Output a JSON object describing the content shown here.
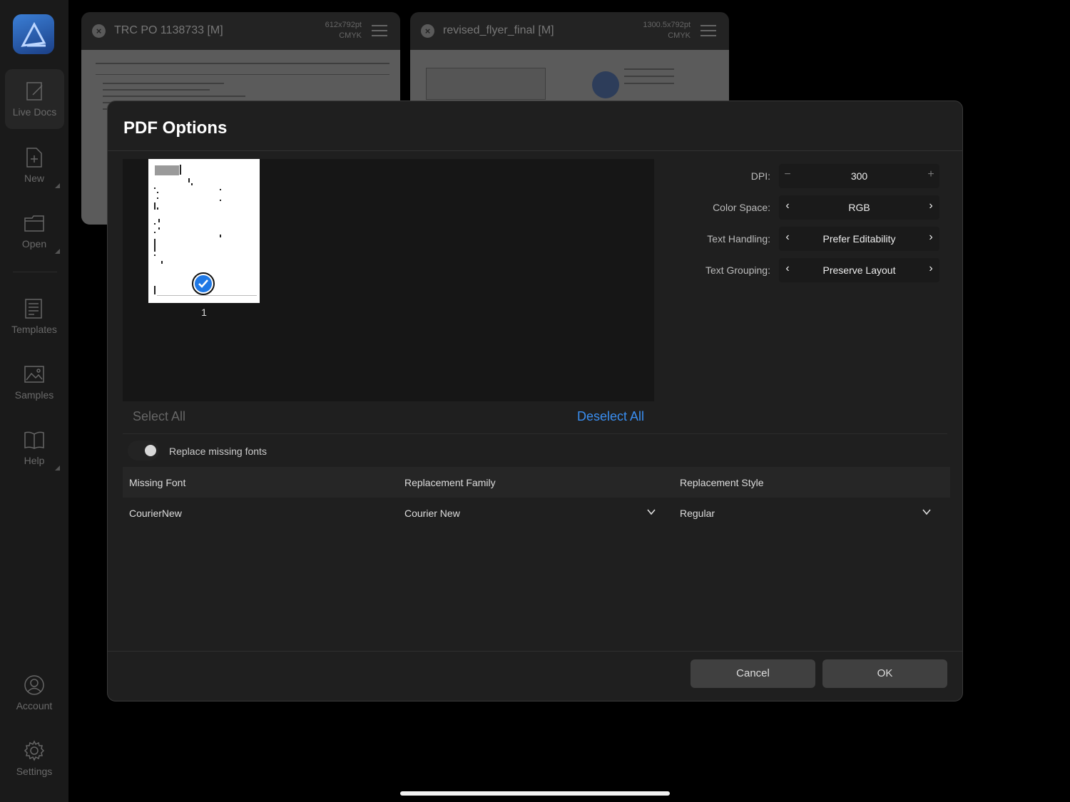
{
  "sidebar": {
    "items": [
      {
        "label": "Live Docs"
      },
      {
        "label": "New"
      },
      {
        "label": "Open"
      },
      {
        "label": "Templates"
      },
      {
        "label": "Samples"
      },
      {
        "label": "Help"
      },
      {
        "label": "Account"
      },
      {
        "label": "Settings"
      }
    ]
  },
  "documents": [
    {
      "title": "TRC PO 1138733 [M]",
      "size": "612x792pt",
      "color_mode": "CMYK"
    },
    {
      "title": "revised_flyer_final [M]",
      "size": "1300.5x792pt",
      "color_mode": "CMYK"
    }
  ],
  "dialog": {
    "title": "PDF Options",
    "page_number": "1",
    "select_all": "Select All",
    "deselect_all": "Deselect All",
    "replace_fonts_label": "Replace missing fonts",
    "settings": {
      "dpi_label": "DPI:",
      "dpi_value": "300",
      "dpi_minus": "−",
      "dpi_plus": "+",
      "color_space_label": "Color Space:",
      "color_space_value": "RGB",
      "text_handling_label": "Text Handling:",
      "text_handling_value": "Prefer Editability",
      "text_grouping_label": "Text Grouping:",
      "text_grouping_value": "Preserve Layout"
    },
    "font_table": {
      "headers": [
        "Missing Font",
        "Replacement Family",
        "Replacement Style"
      ],
      "rows": [
        {
          "missing": "CourierNew",
          "family": "Courier New",
          "style": "Regular"
        }
      ]
    },
    "cancel_label": "Cancel",
    "ok_label": "OK"
  },
  "colors": {
    "accent": "#3a8ef0",
    "background": "#1f1f1f"
  }
}
